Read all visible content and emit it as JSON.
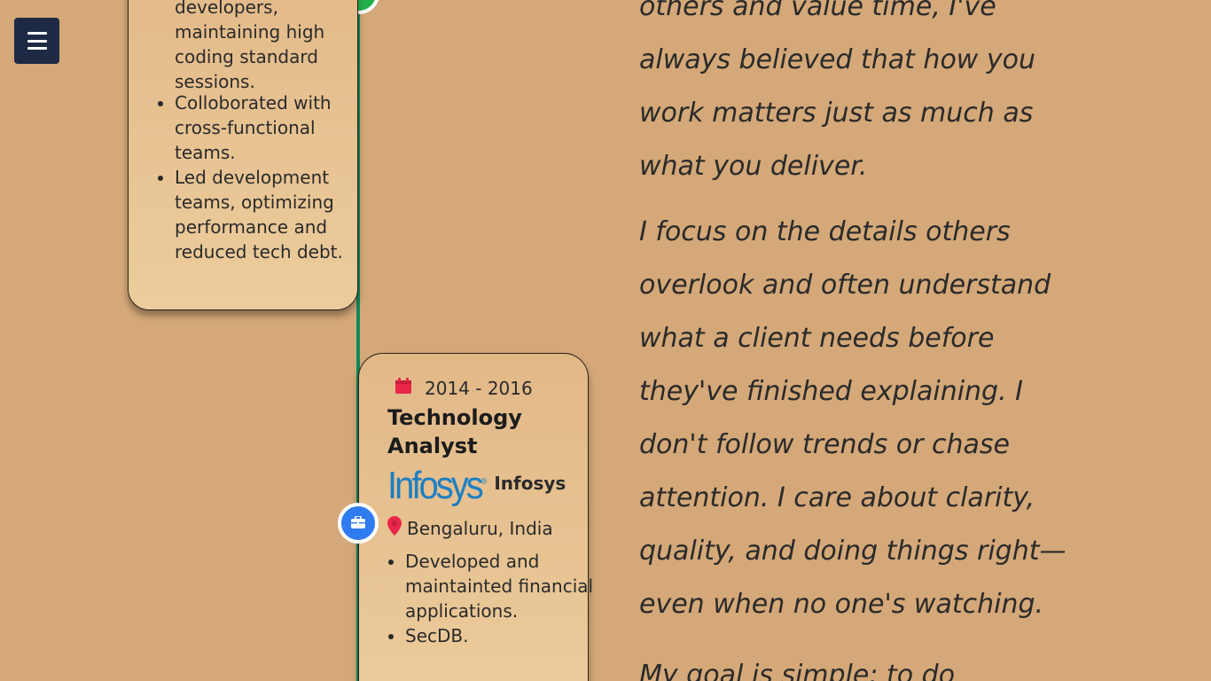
{
  "menu": {
    "icon": "hamburger-menu-icon"
  },
  "previous_job": {
    "fragment_lines": [
      "developers,",
      "maintaining high",
      "coding standard",
      "sessions."
    ],
    "bullets": [
      "Colloborated with cross-functional teams.",
      "Led development teams, optimizing performance and reduced tech debt."
    ]
  },
  "job": {
    "dates": "2014 - 2016",
    "title": "Technology Analyst",
    "company_logo_text": "Infosys",
    "company_logo_mark": "®",
    "company_name": "Infosys",
    "location": "Bengaluru, India",
    "bullets": [
      "Developed and maintainted financial applications.",
      "SecDB."
    ],
    "icons": {
      "calendar": "calendar-icon",
      "location": "map-pin-icon",
      "job": "briefcase-icon"
    }
  },
  "about": {
    "fragment": "others and value time, I've always believed that how you work matters just as much as what you deliver.",
    "paragraph_2": "I focus on the details others overlook and often understand what a client needs before they've finished explaining. I don't follow trends or chase attention. I care about clarity, quality, and doing things right—even when no one's watching.",
    "paragraph_3": "My goal is simple: to do"
  },
  "colors": {
    "background": "#d4a878",
    "menu_button": "#1e2a44",
    "timeline_line": "#0f8a5a",
    "timeline_dot_top": "#22b14c",
    "timeline_dot_job": "#2f7bf0",
    "icon_red": "#e8274b",
    "logo_blue": "#1b7fc4"
  }
}
